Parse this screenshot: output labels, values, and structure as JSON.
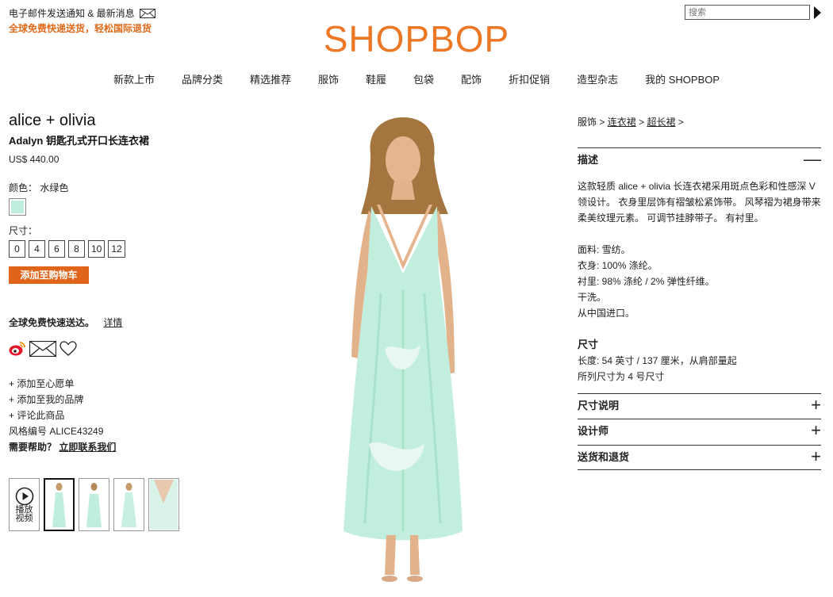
{
  "header": {
    "email_notice": "电子邮件发送通知 & 最新消息",
    "promo": "全球免费快递送货，轻松国际退货",
    "logo": "SHOPBOP",
    "search_placeholder": "搜索"
  },
  "nav": [
    "新款上市",
    "品牌分类",
    "精选推荐",
    "服饰",
    "鞋履",
    "包袋",
    "配饰",
    "折扣促销",
    "造型杂志",
    "我的 SHOPBOP"
  ],
  "product": {
    "brand": "alice + olivia",
    "name": "Adalyn 钥匙孔式开口长连衣裙",
    "price": "US$ 440.00",
    "color_label": "颜色：  水绿色",
    "size_label": "尺寸：",
    "sizes": [
      "0",
      "4",
      "6",
      "8",
      "10",
      "12"
    ],
    "add_to_cart": "添加至购物车",
    "shipping": "全球免费快速送达。",
    "shipping_link": "详情",
    "links": [
      "+ 添加至心愿单",
      "+ 添加至我的品牌",
      "+ 评论此商品"
    ],
    "style_no": "风格编号 ALICE43249",
    "help": "需要帮助？",
    "help_link": "立即联系我们",
    "play_label": "播放\n视频",
    "swatch_color": "#bfeedd"
  },
  "breadcrumb": {
    "root": "服饰",
    "sep": ">",
    "l1": "连衣裙",
    "l2": "超长裙"
  },
  "details": {
    "desc_title": "描述",
    "desc_text": "这款轻质 alice + olivia 长连衣裙采用斑点色彩和性感深 V 领设计。 衣身里层饰有褶皱松紧饰带。 风琴褶为裙身带来柔美纹理元素。 可调节挂脖带子。 有衬里。",
    "fabric": [
      "面料: 雪纺。",
      "衣身: 100% 涤纶。",
      "衬里: 98% 涤纶 / 2% 弹性纤维。",
      "干洗。",
      "从中国进口。"
    ],
    "size_title": "尺寸",
    "size_lines": [
      "长度: 54 英寸 / 137 厘米，从肩部量起",
      "所列尺寸为 4 号尺寸"
    ],
    "sections": [
      "尺寸说明",
      "设计师",
      "送货和退货"
    ]
  },
  "colors": {
    "accent": "#ec7725",
    "button": "#e0651b",
    "dress": "#bfeedd"
  }
}
